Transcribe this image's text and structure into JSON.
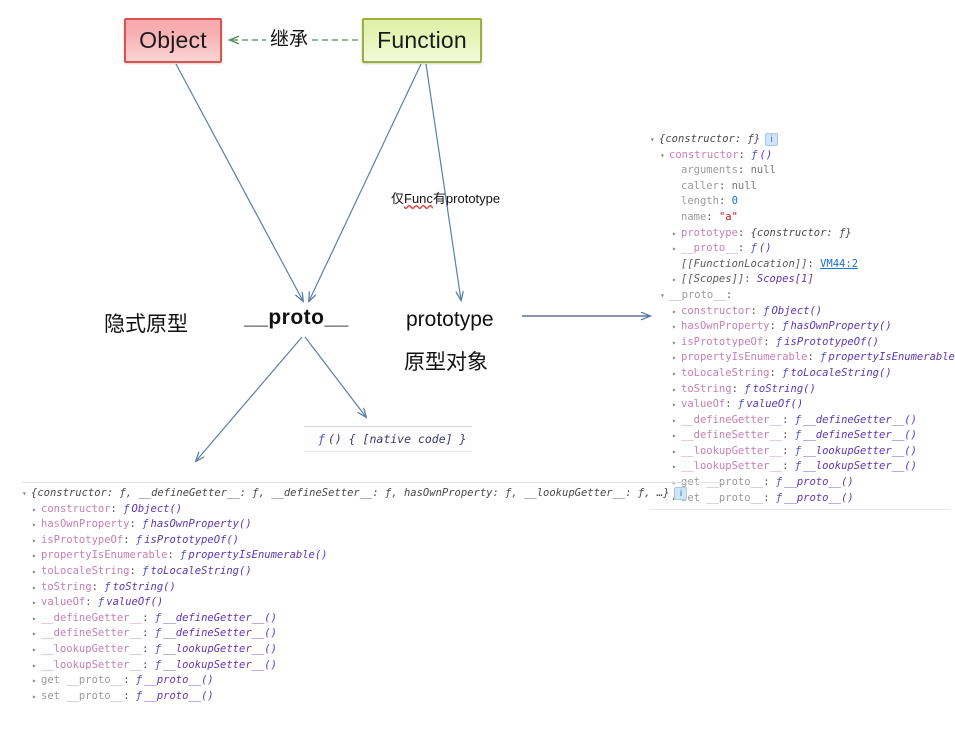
{
  "diagram": {
    "boxes": [
      {
        "id": "object",
        "label": "Object"
      },
      {
        "id": "function",
        "label": "Function"
      }
    ],
    "labels": {
      "inherit": "继承",
      "only_func_prefix": "仅",
      "only_func_spell": "Func",
      "only_func_suffix": "有prototype",
      "implicit_prototype": "隐式原型",
      "proto": "__proto__",
      "prototype": "prototype",
      "prototype_object": "原型对象"
    },
    "native_code": {
      "fn_glyph": "ƒ",
      "text": "() { [native code] }"
    },
    "arrow_color": "#5b7fa6",
    "inherit_arrow_color": "#4a8a5c"
  },
  "console_right": {
    "rows": [
      {
        "indent": 0,
        "tri": "▾",
        "parts": [
          {
            "cls": "c-sum",
            "t": "{constructor: ƒ}"
          }
        ],
        "badge": "i"
      },
      {
        "indent": 1,
        "tri": "▾",
        "parts": [
          {
            "cls": "c-key",
            "t": "constructor"
          },
          {
            "cls": "c-punct",
            "t": ": "
          },
          {
            "cls": "fnmark",
            "t": "ƒ"
          },
          {
            "cls": "c-val",
            "t": "()"
          }
        ]
      },
      {
        "indent": 2,
        "tri": "",
        "parts": [
          {
            "cls": "c-key-dim",
            "t": "arguments"
          },
          {
            "cls": "c-punct",
            "t": ": "
          },
          {
            "cls": "c-null",
            "t": "null"
          }
        ]
      },
      {
        "indent": 2,
        "tri": "",
        "parts": [
          {
            "cls": "c-key-dim",
            "t": "caller"
          },
          {
            "cls": "c-punct",
            "t": ": "
          },
          {
            "cls": "c-null",
            "t": "null"
          }
        ]
      },
      {
        "indent": 2,
        "tri": "",
        "parts": [
          {
            "cls": "c-key-dim",
            "t": "length"
          },
          {
            "cls": "c-punct",
            "t": ": "
          },
          {
            "cls": "c-num",
            "t": "0"
          }
        ]
      },
      {
        "indent": 2,
        "tri": "",
        "parts": [
          {
            "cls": "c-key-dim",
            "t": "name"
          },
          {
            "cls": "c-punct",
            "t": ": "
          },
          {
            "cls": "c-str",
            "t": "\"a\""
          }
        ]
      },
      {
        "indent": 2,
        "tri": "▸",
        "parts": [
          {
            "cls": "c-key",
            "t": "prototype"
          },
          {
            "cls": "c-punct",
            "t": ": "
          },
          {
            "cls": "c-sum",
            "t": "{constructor: ƒ}"
          }
        ]
      },
      {
        "indent": 2,
        "tri": "▸",
        "parts": [
          {
            "cls": "c-key",
            "t": "__proto__"
          },
          {
            "cls": "c-punct",
            "t": ": "
          },
          {
            "cls": "fnmark",
            "t": "ƒ"
          },
          {
            "cls": "c-val",
            "t": "()"
          }
        ]
      },
      {
        "indent": 2,
        "tri": "",
        "parts": [
          {
            "cls": "c-internal",
            "t": "[[FunctionLocation]]"
          },
          {
            "cls": "c-punct",
            "t": ": "
          },
          {
            "cls": "c-link",
            "t": "VM44:2"
          }
        ]
      },
      {
        "indent": 2,
        "tri": "▸",
        "parts": [
          {
            "cls": "c-internal",
            "t": "[[Scopes]]"
          },
          {
            "cls": "c-punct",
            "t": ": "
          },
          {
            "cls": "c-val",
            "t": "Scopes[1]"
          }
        ]
      },
      {
        "indent": 1,
        "tri": "▾",
        "parts": [
          {
            "cls": "c-key-dim",
            "t": "__proto__"
          },
          {
            "cls": "c-punct",
            "t": ":"
          }
        ]
      },
      {
        "indent": 2,
        "tri": "▸",
        "parts": [
          {
            "cls": "c-key",
            "t": "constructor"
          },
          {
            "cls": "c-punct",
            "t": ": "
          },
          {
            "cls": "fnmark",
            "t": "ƒ"
          },
          {
            "cls": "c-val",
            "t": "Object()"
          }
        ]
      },
      {
        "indent": 2,
        "tri": "▸",
        "parts": [
          {
            "cls": "c-key",
            "t": "hasOwnProperty"
          },
          {
            "cls": "c-punct",
            "t": ": "
          },
          {
            "cls": "fnmark",
            "t": "ƒ"
          },
          {
            "cls": "c-val",
            "t": "hasOwnProperty()"
          }
        ]
      },
      {
        "indent": 2,
        "tri": "▸",
        "parts": [
          {
            "cls": "c-key",
            "t": "isPrototypeOf"
          },
          {
            "cls": "c-punct",
            "t": ": "
          },
          {
            "cls": "fnmark",
            "t": "ƒ"
          },
          {
            "cls": "c-val",
            "t": "isPrototypeOf()"
          }
        ]
      },
      {
        "indent": 2,
        "tri": "▸",
        "parts": [
          {
            "cls": "c-key",
            "t": "propertyIsEnumerable"
          },
          {
            "cls": "c-punct",
            "t": ": "
          },
          {
            "cls": "fnmark",
            "t": "ƒ"
          },
          {
            "cls": "c-val",
            "t": "propertyIsEnumerable()"
          }
        ]
      },
      {
        "indent": 2,
        "tri": "▸",
        "parts": [
          {
            "cls": "c-key",
            "t": "toLocaleString"
          },
          {
            "cls": "c-punct",
            "t": ": "
          },
          {
            "cls": "fnmark",
            "t": "ƒ"
          },
          {
            "cls": "c-val",
            "t": "toLocaleString()"
          }
        ]
      },
      {
        "indent": 2,
        "tri": "▸",
        "parts": [
          {
            "cls": "c-key",
            "t": "toString"
          },
          {
            "cls": "c-punct",
            "t": ": "
          },
          {
            "cls": "fnmark",
            "t": "ƒ"
          },
          {
            "cls": "c-val",
            "t": "toString()"
          }
        ]
      },
      {
        "indent": 2,
        "tri": "▸",
        "parts": [
          {
            "cls": "c-key",
            "t": "valueOf"
          },
          {
            "cls": "c-punct",
            "t": ": "
          },
          {
            "cls": "fnmark",
            "t": "ƒ"
          },
          {
            "cls": "c-val",
            "t": "valueOf()"
          }
        ]
      },
      {
        "indent": 2,
        "tri": "▸",
        "parts": [
          {
            "cls": "c-key",
            "t": "__defineGetter__"
          },
          {
            "cls": "c-punct",
            "t": ": "
          },
          {
            "cls": "fnmark",
            "t": "ƒ"
          },
          {
            "cls": "c-val",
            "t": "__defineGetter__()"
          }
        ]
      },
      {
        "indent": 2,
        "tri": "▸",
        "parts": [
          {
            "cls": "c-key",
            "t": "__defineSetter__"
          },
          {
            "cls": "c-punct",
            "t": ": "
          },
          {
            "cls": "fnmark",
            "t": "ƒ"
          },
          {
            "cls": "c-val",
            "t": "__defineSetter__()"
          }
        ]
      },
      {
        "indent": 2,
        "tri": "▸",
        "parts": [
          {
            "cls": "c-key",
            "t": "__lookupGetter__"
          },
          {
            "cls": "c-punct",
            "t": ": "
          },
          {
            "cls": "fnmark",
            "t": "ƒ"
          },
          {
            "cls": "c-val",
            "t": "__lookupGetter__()"
          }
        ]
      },
      {
        "indent": 2,
        "tri": "▸",
        "parts": [
          {
            "cls": "c-key",
            "t": "__lookupSetter__"
          },
          {
            "cls": "c-punct",
            "t": ": "
          },
          {
            "cls": "fnmark",
            "t": "ƒ"
          },
          {
            "cls": "c-val",
            "t": "__lookupSetter__()"
          }
        ]
      },
      {
        "indent": 2,
        "tri": "▸",
        "parts": [
          {
            "cls": "c-key-dim",
            "t": "get __proto__"
          },
          {
            "cls": "c-punct",
            "t": ": "
          },
          {
            "cls": "fnmark",
            "t": "ƒ"
          },
          {
            "cls": "c-val",
            "t": "__proto__()"
          }
        ]
      },
      {
        "indent": 2,
        "tri": "▸",
        "parts": [
          {
            "cls": "c-key-dim",
            "t": "set __proto__"
          },
          {
            "cls": "c-punct",
            "t": ": "
          },
          {
            "cls": "fnmark",
            "t": "ƒ"
          },
          {
            "cls": "c-val",
            "t": "__proto__()"
          }
        ]
      }
    ]
  },
  "console_bottom": {
    "rows": [
      {
        "indent": 0,
        "tri": "▾",
        "parts": [
          {
            "cls": "c-sum",
            "t": "{constructor: ƒ, __defineGetter__: ƒ, __defineSetter__: ƒ, hasOwnProperty: ƒ, __lookupGetter__: ƒ, …}"
          }
        ],
        "badge": "i"
      },
      {
        "indent": 1,
        "tri": "▸",
        "parts": [
          {
            "cls": "c-key",
            "t": "constructor"
          },
          {
            "cls": "c-punct",
            "t": ": "
          },
          {
            "cls": "fnmark",
            "t": "ƒ"
          },
          {
            "cls": "c-val",
            "t": "Object()"
          }
        ]
      },
      {
        "indent": 1,
        "tri": "▸",
        "parts": [
          {
            "cls": "c-key",
            "t": "hasOwnProperty"
          },
          {
            "cls": "c-punct",
            "t": ": "
          },
          {
            "cls": "fnmark",
            "t": "ƒ"
          },
          {
            "cls": "c-val",
            "t": "hasOwnProperty()"
          }
        ]
      },
      {
        "indent": 1,
        "tri": "▸",
        "parts": [
          {
            "cls": "c-key",
            "t": "isPrototypeOf"
          },
          {
            "cls": "c-punct",
            "t": ": "
          },
          {
            "cls": "fnmark",
            "t": "ƒ"
          },
          {
            "cls": "c-val",
            "t": "isPrototypeOf()"
          }
        ]
      },
      {
        "indent": 1,
        "tri": "▸",
        "parts": [
          {
            "cls": "c-key",
            "t": "propertyIsEnumerable"
          },
          {
            "cls": "c-punct",
            "t": ": "
          },
          {
            "cls": "fnmark",
            "t": "ƒ"
          },
          {
            "cls": "c-val",
            "t": "propertyIsEnumerable()"
          }
        ]
      },
      {
        "indent": 1,
        "tri": "▸",
        "parts": [
          {
            "cls": "c-key",
            "t": "toLocaleString"
          },
          {
            "cls": "c-punct",
            "t": ": "
          },
          {
            "cls": "fnmark",
            "t": "ƒ"
          },
          {
            "cls": "c-val",
            "t": "toLocaleString()"
          }
        ]
      },
      {
        "indent": 1,
        "tri": "▸",
        "parts": [
          {
            "cls": "c-key",
            "t": "toString"
          },
          {
            "cls": "c-punct",
            "t": ": "
          },
          {
            "cls": "fnmark",
            "t": "ƒ"
          },
          {
            "cls": "c-val",
            "t": "toString()"
          }
        ]
      },
      {
        "indent": 1,
        "tri": "▸",
        "parts": [
          {
            "cls": "c-key",
            "t": "valueOf"
          },
          {
            "cls": "c-punct",
            "t": ": "
          },
          {
            "cls": "fnmark",
            "t": "ƒ"
          },
          {
            "cls": "c-val",
            "t": "valueOf()"
          }
        ]
      },
      {
        "indent": 1,
        "tri": "▸",
        "parts": [
          {
            "cls": "c-key",
            "t": "__defineGetter__"
          },
          {
            "cls": "c-punct",
            "t": ": "
          },
          {
            "cls": "fnmark",
            "t": "ƒ"
          },
          {
            "cls": "c-val",
            "t": "__defineGetter__()"
          }
        ]
      },
      {
        "indent": 1,
        "tri": "▸",
        "parts": [
          {
            "cls": "c-key",
            "t": "__defineSetter__"
          },
          {
            "cls": "c-punct",
            "t": ": "
          },
          {
            "cls": "fnmark",
            "t": "ƒ"
          },
          {
            "cls": "c-val",
            "t": "__defineSetter__()"
          }
        ]
      },
      {
        "indent": 1,
        "tri": "▸",
        "parts": [
          {
            "cls": "c-key",
            "t": "__lookupGetter__"
          },
          {
            "cls": "c-punct",
            "t": ": "
          },
          {
            "cls": "fnmark",
            "t": "ƒ"
          },
          {
            "cls": "c-val",
            "t": "__lookupGetter__()"
          }
        ]
      },
      {
        "indent": 1,
        "tri": "▸",
        "parts": [
          {
            "cls": "c-key",
            "t": "__lookupSetter__"
          },
          {
            "cls": "c-punct",
            "t": ": "
          },
          {
            "cls": "fnmark",
            "t": "ƒ"
          },
          {
            "cls": "c-val",
            "t": "__lookupSetter__()"
          }
        ]
      },
      {
        "indent": 1,
        "tri": "▸",
        "parts": [
          {
            "cls": "c-key-dim",
            "t": "get __proto__"
          },
          {
            "cls": "c-punct",
            "t": ": "
          },
          {
            "cls": "fnmark",
            "t": "ƒ"
          },
          {
            "cls": "c-val",
            "t": "__proto__()"
          }
        ]
      },
      {
        "indent": 1,
        "tri": "▸",
        "parts": [
          {
            "cls": "c-key-dim",
            "t": "set __proto__"
          },
          {
            "cls": "c-punct",
            "t": ": "
          },
          {
            "cls": "fnmark",
            "t": "ƒ"
          },
          {
            "cls": "c-val",
            "t": "__proto__()"
          }
        ]
      }
    ]
  }
}
